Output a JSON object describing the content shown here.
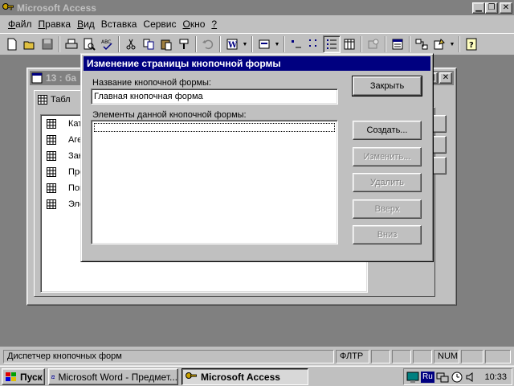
{
  "app": {
    "title": "Microsoft Access"
  },
  "menu": [
    {
      "label": "Файл",
      "key": "Ф",
      "rest": "айл"
    },
    {
      "label": "Правка",
      "key": "П",
      "rest": "равка"
    },
    {
      "label": "Вид",
      "key": "В",
      "rest": "ид"
    },
    {
      "label": "Вставка",
      "key": "",
      "rest": "Вставка"
    },
    {
      "label": "Сервис",
      "key": "",
      "rest": "Сервис"
    },
    {
      "label": "Окно",
      "key": "О",
      "rest": "кно"
    },
    {
      "label": "?",
      "key": "?",
      "rest": ""
    }
  ],
  "db_window": {
    "title": "13 : ба",
    "tab_label": "Табл",
    "objects": [
      "Кат",
      "Аге",
      "Зак",
      "Про",
      "Пок",
      "Эле"
    ]
  },
  "dialog": {
    "title": "Изменение страницы кнопочной формы",
    "name_label": "Название кнопочной формы:",
    "name_value": "Главная кнопочная форма",
    "items_label": "Элементы данной кнопочной формы:",
    "buttons": {
      "close": "Закрыть",
      "create": "Создать...",
      "edit": "Изменить...",
      "delete": "Удалить",
      "up": "Вверх",
      "down": "Вниз"
    }
  },
  "statusbar": {
    "message": "Диспетчер кнопочных форм",
    "filter": "ФЛТР",
    "num": "NUM"
  },
  "taskbar": {
    "start": "Пуск",
    "tasks": [
      "Microsoft Word - Предмет...",
      "Microsoft Access"
    ],
    "language": "Ru",
    "time": "10:33"
  },
  "colors": {
    "face": "#c0c0c0",
    "desktop": "#808080",
    "active_title": "#000080",
    "inactive_title": "#808080"
  }
}
